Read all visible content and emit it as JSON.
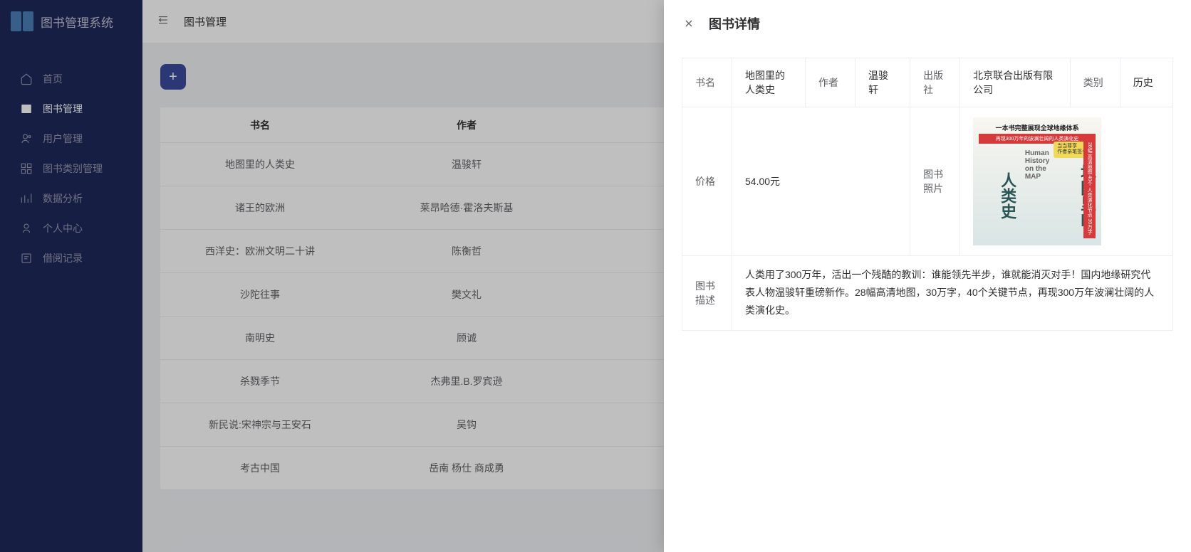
{
  "app": {
    "title": "图书管理系统"
  },
  "sidebar": {
    "items": [
      {
        "label": "首页",
        "icon": "home"
      },
      {
        "label": "图书管理",
        "icon": "book",
        "active": true
      },
      {
        "label": "用户管理",
        "icon": "user"
      },
      {
        "label": "图书类别管理",
        "icon": "grid"
      },
      {
        "label": "数据分析",
        "icon": "chart"
      },
      {
        "label": "个人中心",
        "icon": "person"
      },
      {
        "label": "借阅记录",
        "icon": "record"
      }
    ]
  },
  "header": {
    "breadcrumb": "图书管理"
  },
  "table": {
    "columns": {
      "name": "书名",
      "author": "作者"
    },
    "rows": [
      {
        "name": "地图里的人类史",
        "author": "温骏轩"
      },
      {
        "name": "诸王的欧洲",
        "author": "莱昂哈德·霍洛夫斯基"
      },
      {
        "name": "西洋史：欧洲文明二十讲",
        "author": "陈衡哲"
      },
      {
        "name": "沙陀往事",
        "author": "樊文礼"
      },
      {
        "name": "南明史",
        "author": "顾诚"
      },
      {
        "name": "杀戮季节",
        "author": "杰弗里.B.罗宾逊"
      },
      {
        "name": "新民说:宋神宗与王安石",
        "author": "吴钩"
      },
      {
        "name": "考古中国",
        "author": "岳南 杨仕 商成勇"
      }
    ]
  },
  "drawer": {
    "title": "图书详情",
    "labels": {
      "name": "书名",
      "author": "作者",
      "publisher": "出版社",
      "category": "类别",
      "price": "价格",
      "photo": "图书照片",
      "description": "图书描述"
    },
    "values": {
      "name": "地图里的人类史",
      "author": "温骏轩",
      "publisher": "北京联合出版有限公司",
      "category": "历史",
      "price": "54.00元",
      "description": "人类用了300万年，活出一个残酷的教训：谁能领先半步，谁就能消灭对手！国内地缘研究代表人物温骏轩重磅新作。28幅高清地图，30万字，40个关键节点，再现300万年波澜壮阔的人类演化史。"
    },
    "cover": {
      "top": "一本书完整展现全球地缘体系",
      "band": "再现300万年的波澜壮阔的人类演化史",
      "title_left": "人类史",
      "title_right": "地图里的",
      "badge_line1": "当当尊享",
      "badge_line2": "作者亲笔签名版",
      "side_label": "28幅 高清地图 40个 人类演化节点 30万字"
    }
  }
}
